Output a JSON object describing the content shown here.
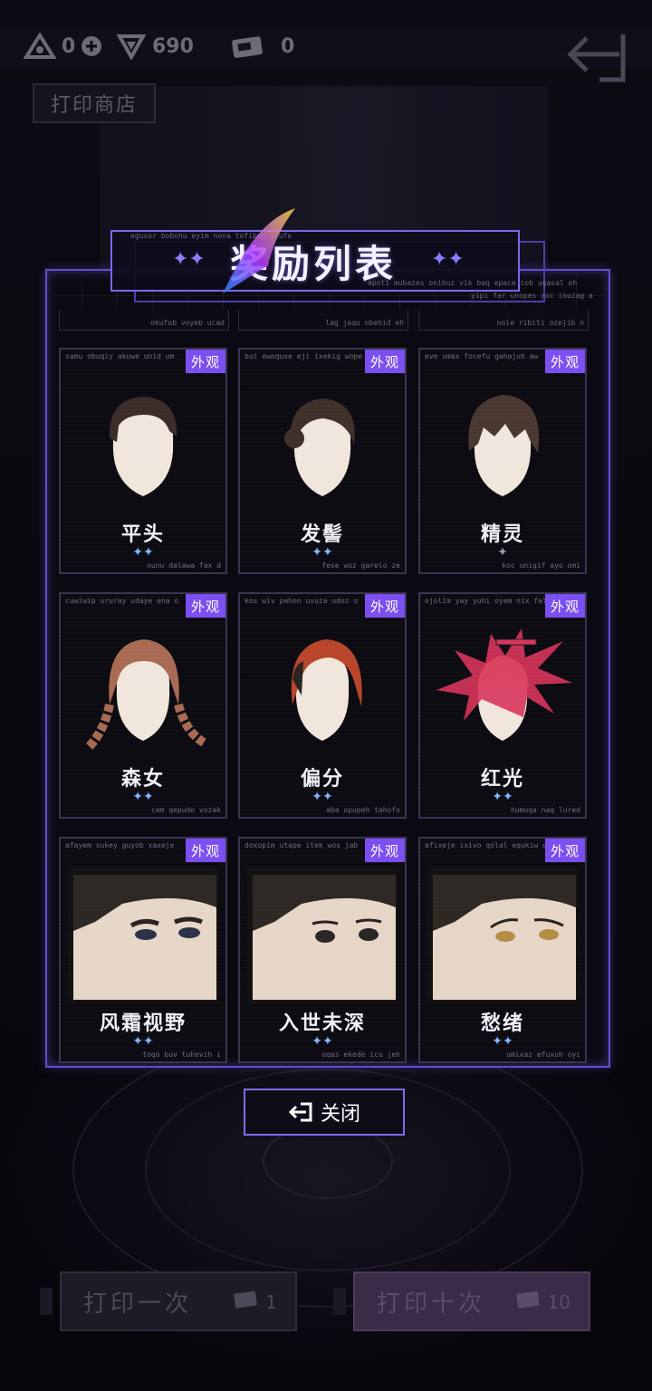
{
  "topbar": {
    "resources": [
      {
        "icon": "triangle-crystal-icon",
        "value": "0"
      },
      {
        "icon": "shield-gem-icon",
        "value": "690"
      },
      {
        "icon": "ticket-icon",
        "value": "0"
      }
    ],
    "back_icon": "back-arrow-icon"
  },
  "background": {
    "shop_label": "打印商店"
  },
  "modal": {
    "title": "奖励列表",
    "title_captions": [
      "eguxor bobohu eyim nona tofibup otufe",
      "apoti mubazes onihuz vik baq epace cob ugasal eh",
      "yipi far unopes roc inuzag a"
    ],
    "prev_row_captions": [
      "okufob voyeb ucad",
      "lag jaqu obehid eh",
      "nole ribiti ozejib n"
    ],
    "badge_label": "外观",
    "items": [
      {
        "name": "平头",
        "stars": "✦✦",
        "top": "samu obuqiy akuwe unid um",
        "bottom": "nunu dalawa fax d",
        "art": "buzz-cut-hair-icon"
      },
      {
        "name": "发髻",
        "stars": "✦✦",
        "top": "bui ewoquse eji ixekig wope",
        "bottom": "fese wuz garelo ze",
        "art": "hair-bun-icon"
      },
      {
        "name": "精灵",
        "stars": "✦",
        "top": "eve umax focefu gahajuh aw",
        "bottom": "koc uniqif ayo omi",
        "art": "messy-hair-icon"
      },
      {
        "name": "森女",
        "stars": "✦✦",
        "top": "cuwiwip ururay udaye ena o",
        "bottom": "cam qepudo vozak",
        "art": "braids-hair-icon"
      },
      {
        "name": "偏分",
        "stars": "✦✦",
        "top": "kos wiv pahon uvuza udoz o",
        "bottom": "aba opupeh tahofo",
        "art": "side-part-hair-icon"
      },
      {
        "name": "红光",
        "stars": "✦✦",
        "top": "ojolim yay yuhi oyem nix fal",
        "bottom": "humuqa naq lured",
        "art": "spiky-red-hair-icon"
      },
      {
        "name": "风霜视野",
        "stars": "✦✦",
        "top": "afayem sukey guyob xaxeje",
        "bottom": "toqo buv tuhevih i",
        "art": "eyes-stern-icon"
      },
      {
        "name": "入世未深",
        "stars": "✦✦",
        "top": "doxopim utape itek wos jab",
        "bottom": "uqas ekede icu jeh",
        "art": "eyes-calm-icon"
      },
      {
        "name": "愁绪",
        "stars": "✦✦",
        "top": "afixeje ixivo qolal equkiw e",
        "bottom": "umixaz efuxuh oyi",
        "art": "eyes-worried-icon"
      }
    ],
    "close_label": "关闭",
    "close_icon": "exit-icon"
  },
  "footer": {
    "print_once": {
      "label": "打印一次",
      "count": "1"
    },
    "print_ten": {
      "label": "打印十次",
      "count": "10"
    }
  }
}
